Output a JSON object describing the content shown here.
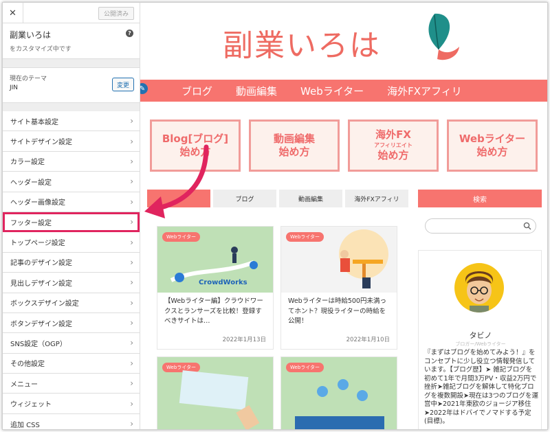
{
  "sidebar": {
    "close_icon": "✕",
    "publish_label": "公開済み",
    "site_title": "副業いろは",
    "customizing_label": "をカスタマイズ中です",
    "help_icon": "?",
    "current_theme_label": "現在のテーマ",
    "theme_name": "JIN",
    "change_label": "変更",
    "items": [
      {
        "label": "サイト基本設定"
      },
      {
        "label": "サイトデザイン設定"
      },
      {
        "label": "カラー設定"
      },
      {
        "label": "ヘッダー設定"
      },
      {
        "label": "ヘッダー画像設定"
      },
      {
        "label": "フッター設定"
      },
      {
        "label": "トップページ設定"
      },
      {
        "label": "記事のデザイン設定"
      },
      {
        "label": "見出しデザイン設定"
      },
      {
        "label": "ボックスデザイン設定"
      },
      {
        "label": "ボタンデザイン設定"
      },
      {
        "label": "SNS設定（OGP）"
      },
      {
        "label": "その他設定"
      },
      {
        "label": "メニュー"
      },
      {
        "label": "ウィジェット"
      },
      {
        "label": "追加 CSS"
      }
    ],
    "highlighted_item": "フッター設定"
  },
  "preview": {
    "logo": "副業いろは",
    "nav": [
      "ブログ",
      "動画編集",
      "Webライター",
      "海外FXアフィリ"
    ],
    "banners": [
      {
        "text": "Blog[ブログ]\n始め方",
        "sub": ""
      },
      {
        "text": "動画編集\n始め方",
        "sub": ""
      },
      {
        "text": "海外FX",
        "sub": "アフィリエイト",
        "text2": "始め方"
      },
      {
        "text": "Webライター\n始め方",
        "sub": ""
      }
    ],
    "tabs": [
      "",
      "ブログ",
      "動画編集",
      "海外FXアフィリ"
    ],
    "cards": [
      {
        "badge": "Webライター",
        "thumb_text": "CrowdWorks",
        "title": "【Webライター編】クラウドワークスとランサーズを比較！登録すべきサイトは…",
        "date": "2022年1月13日"
      },
      {
        "badge": "Webライター",
        "thumb_text": "",
        "title": "Webライターは時給500円未満ってホント？現役ライターの時給を公開！",
        "date": "2022年1月10日"
      },
      {
        "badge": "Webライター",
        "thumb_text": "",
        "title": "",
        "date": ""
      },
      {
        "badge": "Webライター",
        "thumb_text": "",
        "title": "",
        "date": ""
      }
    ],
    "search_heading": "検索",
    "profile": {
      "name": "タビノ",
      "role": "ブロガー/Webライター",
      "description": "『まずはブログを始めてみよう！』をコンセプトに少し役立つ情報発信しています。【ブログ歴】➤ 雑記ブログを初めて1年で月間3万PV・収益2万円で挫折➤雑記ブログを解体して特化ブログを複数開設➤現在は3つのブログを運営中➤2021年東欧のジョージア移住➤2022年はドバイでノマドする予定(目標)。"
    }
  },
  "colors": {
    "accent": "#f7746f",
    "highlight": "#e0245e",
    "wp_blue": "#2271b1"
  }
}
